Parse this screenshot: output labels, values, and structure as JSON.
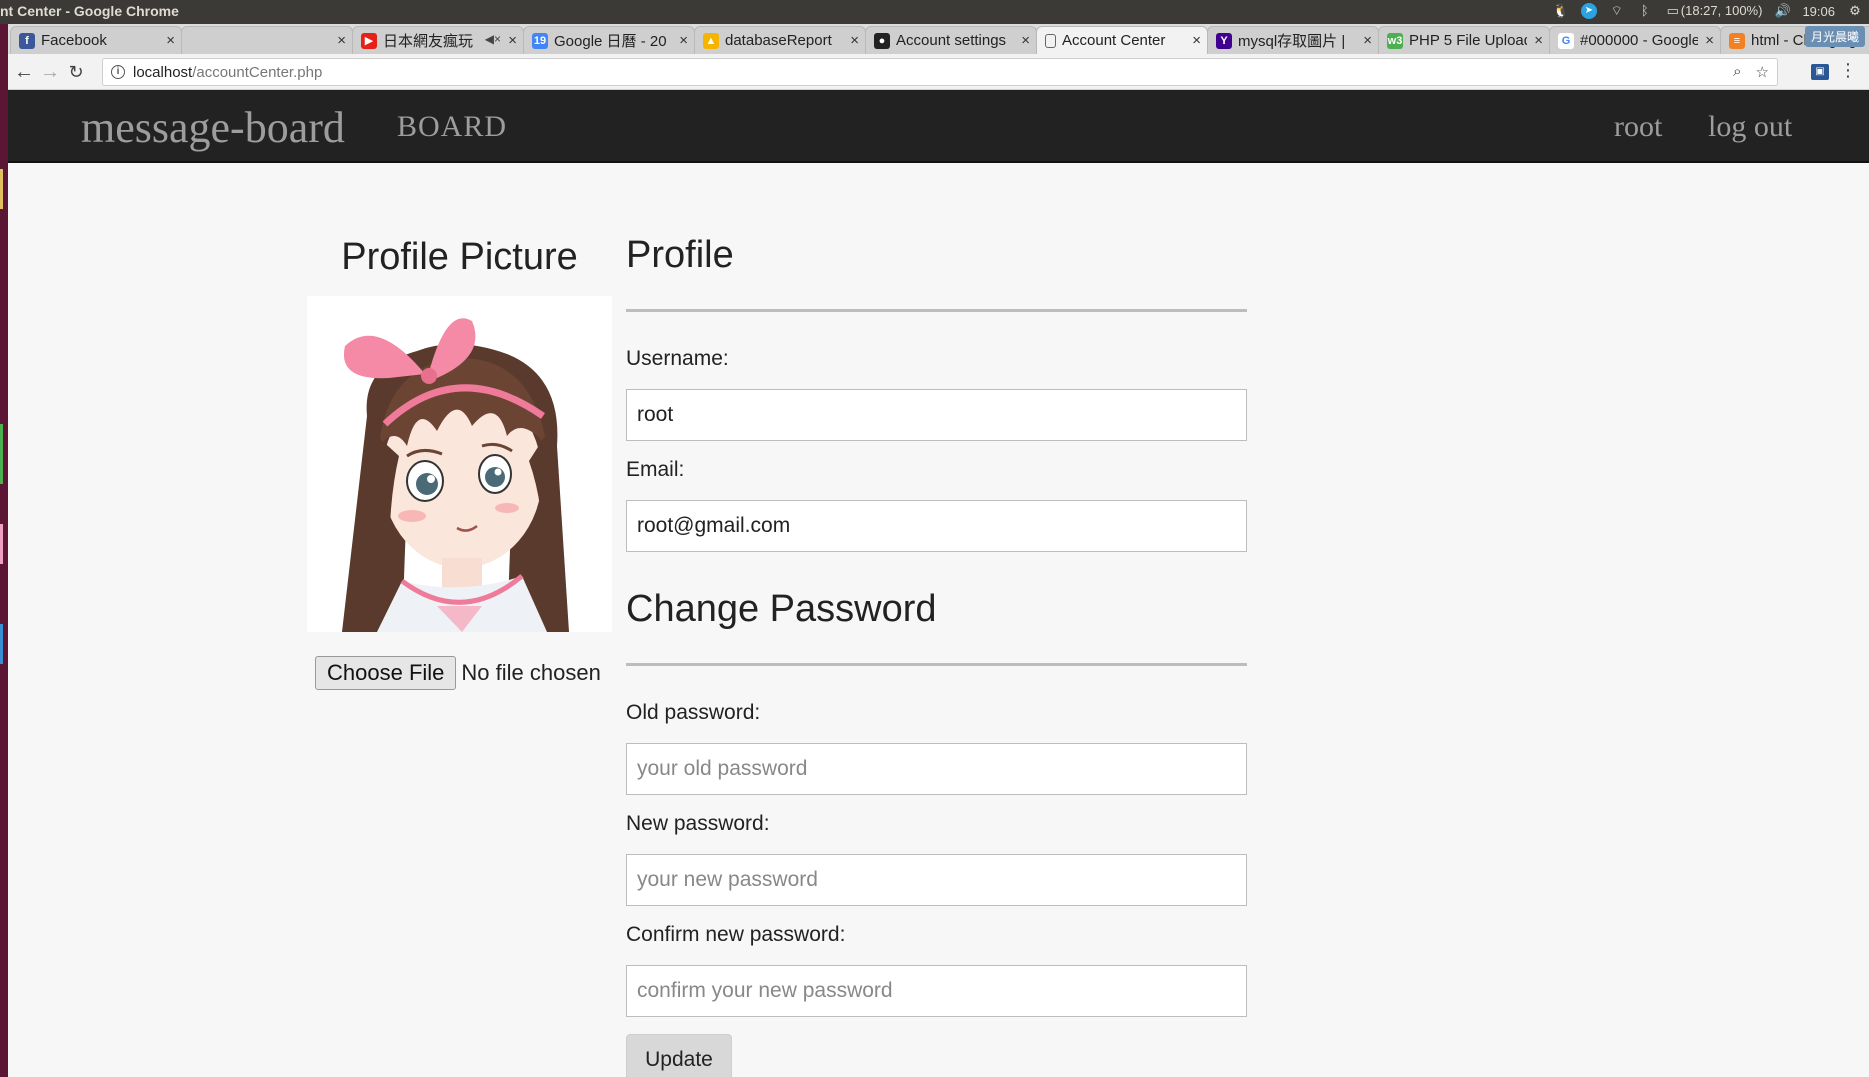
{
  "os": {
    "window_title": "nt Center - Google Chrome",
    "tray": {
      "battery": "(18:27, 100%)",
      "clock": "19:06"
    }
  },
  "browser": {
    "tabs": [
      {
        "label": "Facebook",
        "favicon": "facebook-icon",
        "color": "#3b5998",
        "glyph": "f"
      },
      {
        "label": "",
        "favicon": "blank-icon",
        "color": "#cfcfcf",
        "glyph": ""
      },
      {
        "label": "日本網友瘋玩",
        "favicon": "youtube-icon",
        "color": "#e62117",
        "glyph": "▶"
      },
      {
        "label": "Google 日曆 - 20",
        "favicon": "calendar-icon",
        "color": "#4285f4",
        "glyph": "19"
      },
      {
        "label": "databaseReport",
        "favicon": "drive-icon",
        "color": "#f4b400",
        "glyph": "▲"
      },
      {
        "label": "Account settings",
        "favicon": "github-icon",
        "color": "#222222",
        "glyph": "●"
      },
      {
        "label": "Account Center",
        "favicon": "page-icon",
        "color": "#f2f2f2",
        "glyph": ""
      },
      {
        "label": "mysql存取圖片 |",
        "favicon": "yahoo-icon",
        "color": "#400090",
        "glyph": "Y"
      },
      {
        "label": "PHP 5 File Upload",
        "favicon": "w3schools-icon",
        "color": "#4caf50",
        "glyph": "w3"
      },
      {
        "label": "#000000 - Google",
        "favicon": "google-icon",
        "color": "#ffffff",
        "glyph": "G"
      },
      {
        "label": "html - Changing",
        "favicon": "stackoverflow-icon",
        "color": "#f48024",
        "glyph": "≡"
      }
    ],
    "profile_chip": "月光晨曦",
    "address": {
      "host": "localhost",
      "path": "/accountCenter.php"
    }
  },
  "site": {
    "brand": "message-board",
    "nav_board": "BOARD",
    "nav_user": "root",
    "nav_logout": "log out"
  },
  "profile_picture": {
    "title": "Profile Picture",
    "choose_file": "Choose File",
    "no_file": "No file chosen"
  },
  "profile": {
    "title": "Profile",
    "username_label": "Username:",
    "username_value": "root",
    "email_label": "Email:",
    "email_value": "root@gmail.com"
  },
  "change_password": {
    "title": "Change Password",
    "old_label": "Old password:",
    "old_placeholder": "your old password",
    "new_label": "New password:",
    "new_placeholder": "your new password",
    "confirm_label": "Confirm new password:",
    "confirm_placeholder": "confirm your new password",
    "update_button": "Update"
  }
}
